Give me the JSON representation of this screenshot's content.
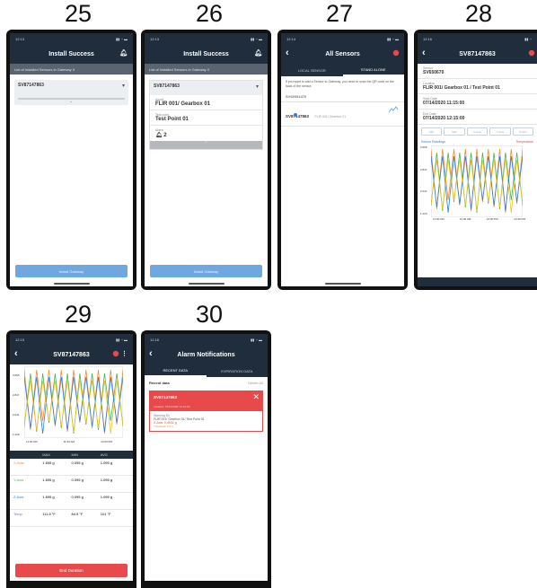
{
  "step_numbers": [
    "25",
    "26",
    "27",
    "28",
    "29",
    "30"
  ],
  "colors": {
    "navbar": "#1f2d3d",
    "accent_blue": "#6fa8e0",
    "alarm_red": "#e8494a",
    "green": "#4caf50",
    "orange": "#f28b30",
    "blue_line": "#2f7fd8",
    "yellow_line": "#f0c419"
  },
  "s25": {
    "time": "12:13",
    "title": "Install Success",
    "subtitle": "List of Installed Sensors in Gateway X",
    "sensor_id": "SV87147863",
    "button": "Install Gateway"
  },
  "s26": {
    "time": "12:13",
    "title": "Install Success",
    "subtitle": "List of Installed Sensors in Gateway X",
    "sensor_id": "SV87147863",
    "asset_label": "Asset",
    "asset_value": "FLIR 001/ Gearbox 01",
    "tp_label": "Test point",
    "tp_value": "Test Point 01",
    "alarm_label": "Alarm",
    "alarm_value": "2",
    "button": "Install Gateway"
  },
  "s27": {
    "time": "12:14",
    "title": "All Sensors",
    "tab_local": "LOCAL SENSOR",
    "tab_stand": "STAND ALONE",
    "info": "If you want to add a Sensor to Gateway, you need to scan the QR code on the back of the sensor.",
    "group": "SV65051470",
    "sensor_id": "SV87147863",
    "sensor_loc": "FLIR 001/ Gearbox 01"
  },
  "s28": {
    "time": "12:16",
    "title": "SV87147863",
    "sensor_label": "Sensor",
    "sensor_value": "SV650670",
    "location_label": "Location",
    "location_value": "FLIR 001/ Gearbox 01 / Test Point 01",
    "start_label": "Start Date",
    "start_value": "07/14/2020 11:15:00",
    "end_label": "End Date",
    "end_value": "07/14/2020 12:15:00",
    "buttons": [
      "Min",
      "Max",
      "X-Axis",
      "Y-Axis",
      "Z-Axis"
    ],
    "chart_title": "Sensor Readings",
    "chart_right": "Temperature",
    "y_ticks": [
      "3.665",
      "2.847",
      "2.041",
      "1.229"
    ],
    "x_ticks": [
      "11:00 AM",
      "11:30 AM",
      "12:00 PM",
      "12:30 PM"
    ]
  },
  "s29": {
    "time": "12:15",
    "title": "SV87147863",
    "y_ticks": [
      "3.665",
      "2.847",
      "2.041",
      "1.229"
    ],
    "x_ticks": [
      "11:00 AM",
      "11:30 AM",
      "12:00 PM"
    ],
    "headers": [
      "",
      "MAX",
      "MIN",
      "AVG"
    ],
    "rows": [
      {
        "name": "X-Axis",
        "max": "1.695 g",
        "min": "0.095 g",
        "avg": "1.095 g"
      },
      {
        "name": "Y-Axis",
        "max": "1.695 g",
        "min": "0.095 g",
        "avg": "1.095 g"
      },
      {
        "name": "Z-Axis",
        "max": "1.695 g",
        "min": "0.095 g",
        "avg": "1.095 g"
      },
      {
        "name": "Temp",
        "max": "111.5 °F",
        "min": "84.9 °F",
        "avg": "101 °F"
      }
    ],
    "button": "End Duration"
  },
  "s30": {
    "time": "12:16",
    "title": "Alarm Notifications",
    "tab_recent": "RECENT DATA",
    "tab_exp": "EXPIRATION DATA",
    "recent_label": "Recent data",
    "recent_right": "Delete All",
    "alarm_id": "SV87147863",
    "alarm_line": "Installed: 07/14/2020 12:01:00",
    "alarm_loc_label": "Warning Rx",
    "alarm_loc": "FLIR 001/ Gearbox 01/ Test Point 01",
    "alarm_value": "X-Axis: 0.4932 g",
    "alarm_time": "Threshold: 0.5 g"
  }
}
